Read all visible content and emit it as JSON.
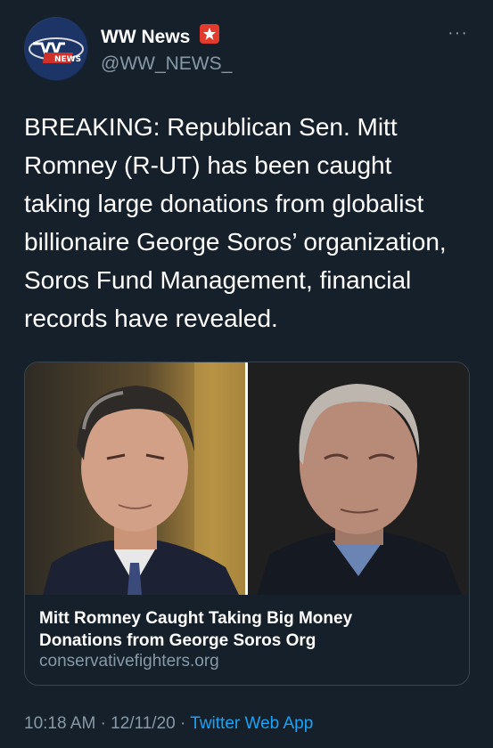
{
  "tweet": {
    "author": {
      "display_name": "WW News",
      "handle": "@WW_NEWS_",
      "avatar_text": "WW NEWS"
    },
    "text": "BREAKING: Republican Sen. Mitt\nRomney (R-UT) has been caught\ntaking large donations from globalist\nbillionaire George Soros’ organization,\nSoros Fund Management, financial\nrecords have revealed.",
    "card": {
      "title": "Mitt Romney Caught Taking Big Money\nDonations from George Soros Org",
      "domain": "conservativefighters.org"
    },
    "meta": {
      "time": "10:18 AM",
      "separator": "·",
      "date": "12/11/20",
      "app": "Twitter Web App"
    }
  },
  "colors": {
    "background": "#15202b",
    "secondary_text": "#8899a6",
    "link": "#1da1f2",
    "badge": "#e23b2e"
  }
}
